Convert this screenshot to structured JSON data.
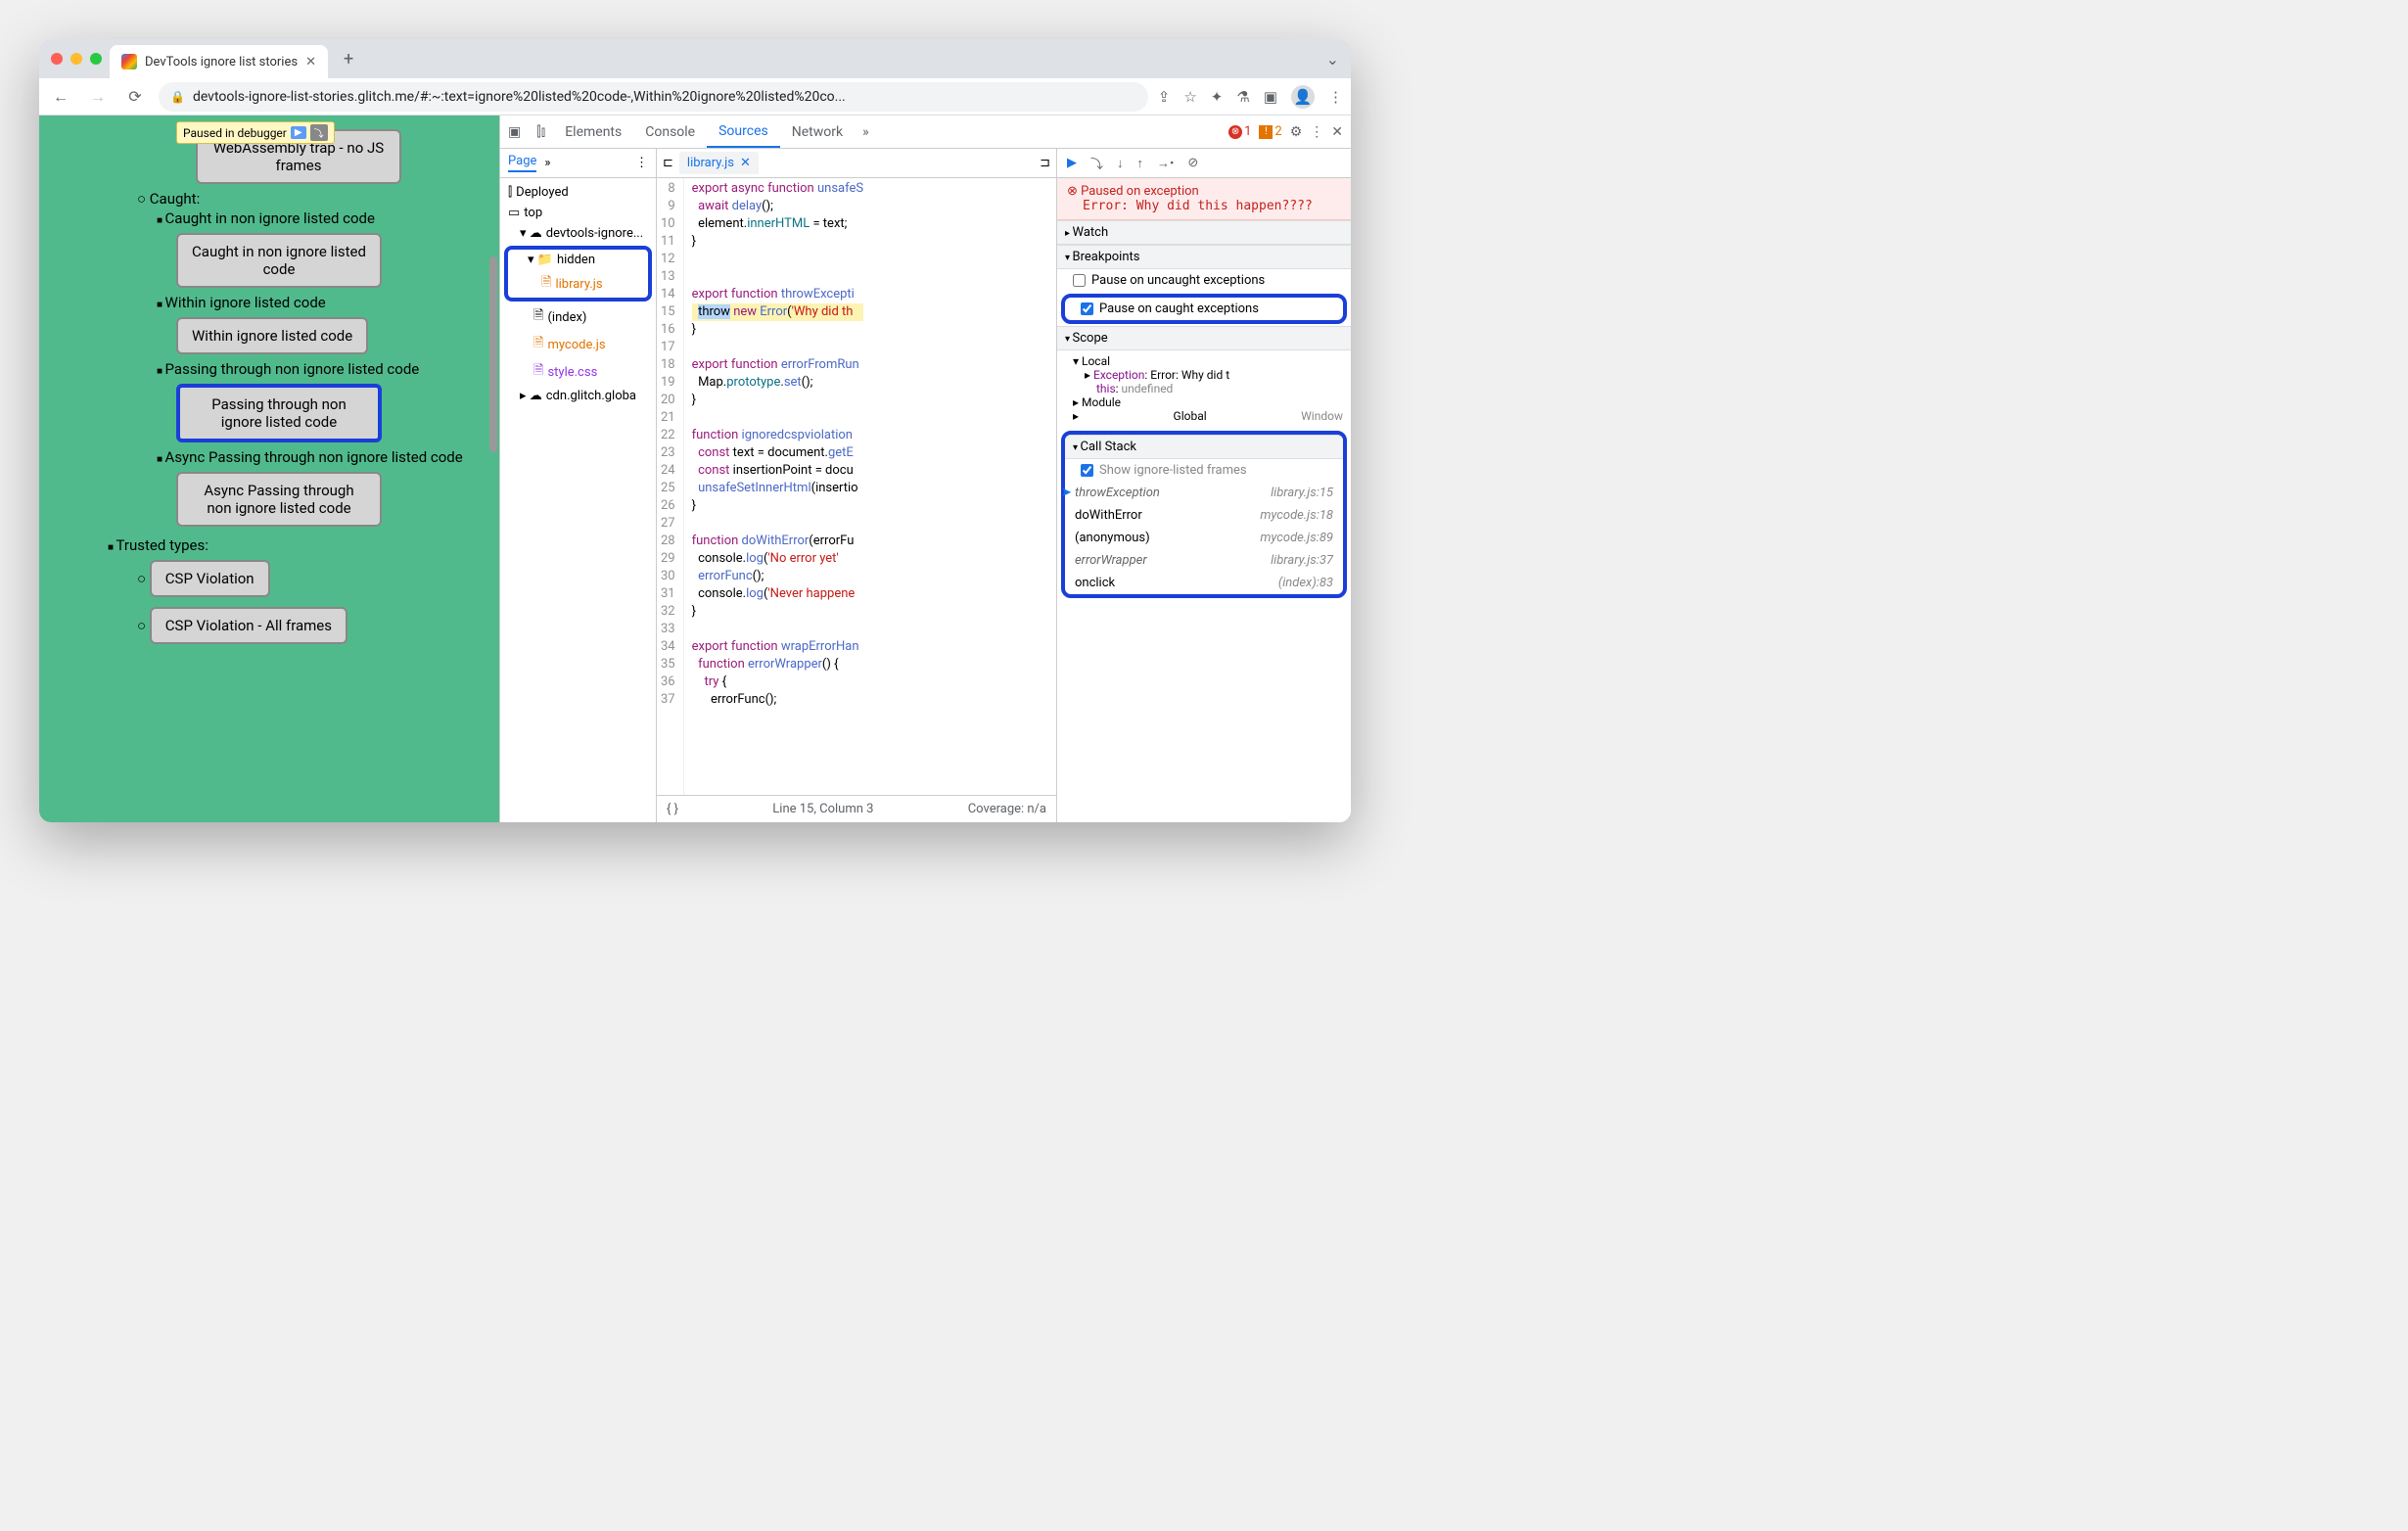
{
  "browser": {
    "tab_title": "DevTools ignore list stories",
    "url": "devtools-ignore-list-stories.glitch.me/#:~:text=ignore%20listed%20code-,Within%20ignore%20listed%20co..."
  },
  "paused_badge": "Paused in debugger",
  "page": {
    "caught_label": "Caught:",
    "items": [
      {
        "text": "WebAssembly trap - no JS frames",
        "type": "btn"
      },
      {
        "text": "Caught in non ignore listed code",
        "type": "li"
      },
      {
        "text": "Caught in non ignore listed code",
        "type": "btn"
      },
      {
        "text": "Within ignore listed code",
        "type": "li"
      },
      {
        "text": "Within ignore listed code",
        "type": "btn"
      },
      {
        "text": "Passing through non ignore listed code",
        "type": "li"
      },
      {
        "text": "Passing through non ignore listed code",
        "type": "btn",
        "hl": true
      },
      {
        "text": "Async Passing through non ignore listed code",
        "type": "li"
      },
      {
        "text": "Async Passing through non ignore listed code",
        "type": "btn"
      }
    ],
    "trusted_types": "Trusted types:",
    "tt_items": [
      "CSP Violation",
      "CSP Violation - All frames"
    ]
  },
  "devtools": {
    "tabs": [
      "Elements",
      "Console",
      "Sources",
      "Network"
    ],
    "active_tab": "Sources",
    "errors": 1,
    "warnings": 2,
    "page_tab": "Page",
    "filetree": {
      "deployed": "Deployed",
      "top": "top",
      "origin": "devtools-ignore...",
      "hidden": "hidden",
      "libraryjs": "library.js",
      "index": "(index)",
      "mycode": "mycode.js",
      "stylecss": "style.css",
      "cdn": "cdn.glitch.globa"
    },
    "open_file": "library.js",
    "code_lines": [
      {
        "n": 8,
        "html": "<span class='kw'>export</span> <span class='kw'>async</span> <span class='kw'>function</span> <span class='fn'>unsafeS</span>"
      },
      {
        "n": 9,
        "html": "  <span class='kw'>await</span> <span class='fn'>delay</span>();"
      },
      {
        "n": 10,
        "html": "  element.<span class='var2'>innerHTML</span> = text;"
      },
      {
        "n": 11,
        "html": "}"
      },
      {
        "n": 12,
        "html": ""
      },
      {
        "n": 13,
        "html": ""
      },
      {
        "n": 14,
        "html": "<span class='kw'>export</span> <span class='kw'>function</span> <span class='fn'>throwExcepti</span>"
      },
      {
        "n": 15,
        "html": "  <span class='sel'>throw</span> <span class='kw'>new</span> <span class='fn'>Error</span>(<span class='str'>'Why did th</span>",
        "hl": true
      },
      {
        "n": 16,
        "html": "}"
      },
      {
        "n": 17,
        "html": ""
      },
      {
        "n": 18,
        "html": "<span class='kw'>export</span> <span class='kw'>function</span> <span class='fn'>errorFromRun</span>"
      },
      {
        "n": 19,
        "html": "  Map.<span class='var2'>prototype</span>.<span class='fn'>set</span>();"
      },
      {
        "n": 20,
        "html": "}"
      },
      {
        "n": 21,
        "html": ""
      },
      {
        "n": 22,
        "html": "<span class='kw'>function</span> <span class='fn'>ignoredcspviolation</span>"
      },
      {
        "n": 23,
        "html": "  <span class='kw'>const</span> text = document.<span class='fn'>getE</span>"
      },
      {
        "n": 24,
        "html": "  <span class='kw'>const</span> insertionPoint = docu"
      },
      {
        "n": 25,
        "html": "  <span class='fn'>unsafeSetInnerHtml</span>(insertio"
      },
      {
        "n": 26,
        "html": "}"
      },
      {
        "n": 27,
        "html": ""
      },
      {
        "n": 28,
        "html": "<span class='kw'>function</span> <span class='fn'>doWithError</span>(errorFu"
      },
      {
        "n": 29,
        "html": "  console.<span class='fn'>log</span>(<span class='str'>'No error yet'</span>"
      },
      {
        "n": 30,
        "html": "  <span class='fn'>errorFunc</span>();"
      },
      {
        "n": 31,
        "html": "  console.<span class='fn'>log</span>(<span class='str'>'Never happene</span>"
      },
      {
        "n": 32,
        "html": "}"
      },
      {
        "n": 33,
        "html": ""
      },
      {
        "n": 34,
        "html": "<span class='kw'>export</span> <span class='kw'>function</span> <span class='fn'>wrapErrorHan</span>"
      },
      {
        "n": 35,
        "html": "  <span class='kw'>function</span> <span class='fn'>errorWrapper</span>() {"
      },
      {
        "n": 36,
        "html": "    <span class='kw'>try</span> {"
      },
      {
        "n": 37,
        "html": "      errorFunc();"
      }
    ],
    "status_line": "Line 15, Column 3",
    "coverage": "Coverage: n/a",
    "pause_reason": "Paused on exception",
    "pause_error": "Error: Why did this happen????",
    "sections": {
      "watch": "Watch",
      "breakpoints": "Breakpoints",
      "scope": "Scope",
      "callstack": "Call Stack"
    },
    "bp_uncaught": "Pause on uncaught exceptions",
    "bp_caught": "Pause on caught exceptions",
    "scope_local": "Local",
    "scope_exception": "Exception",
    "scope_exception_val": "Error: Why did t",
    "scope_this": "this",
    "scope_this_val": "undefined",
    "scope_module": "Module",
    "scope_global": "Global",
    "scope_global_val": "Window",
    "show_ignored": "Show ignore-listed frames",
    "callstack": [
      {
        "name": "throwException",
        "loc": "library.js:15",
        "curr": true,
        "ig": true
      },
      {
        "name": "doWithError",
        "loc": "mycode.js:18"
      },
      {
        "name": "(anonymous)",
        "loc": "mycode.js:89"
      },
      {
        "name": "errorWrapper",
        "loc": "library.js:37",
        "ig": true
      },
      {
        "name": "onclick",
        "loc": "(index):83"
      }
    ]
  }
}
